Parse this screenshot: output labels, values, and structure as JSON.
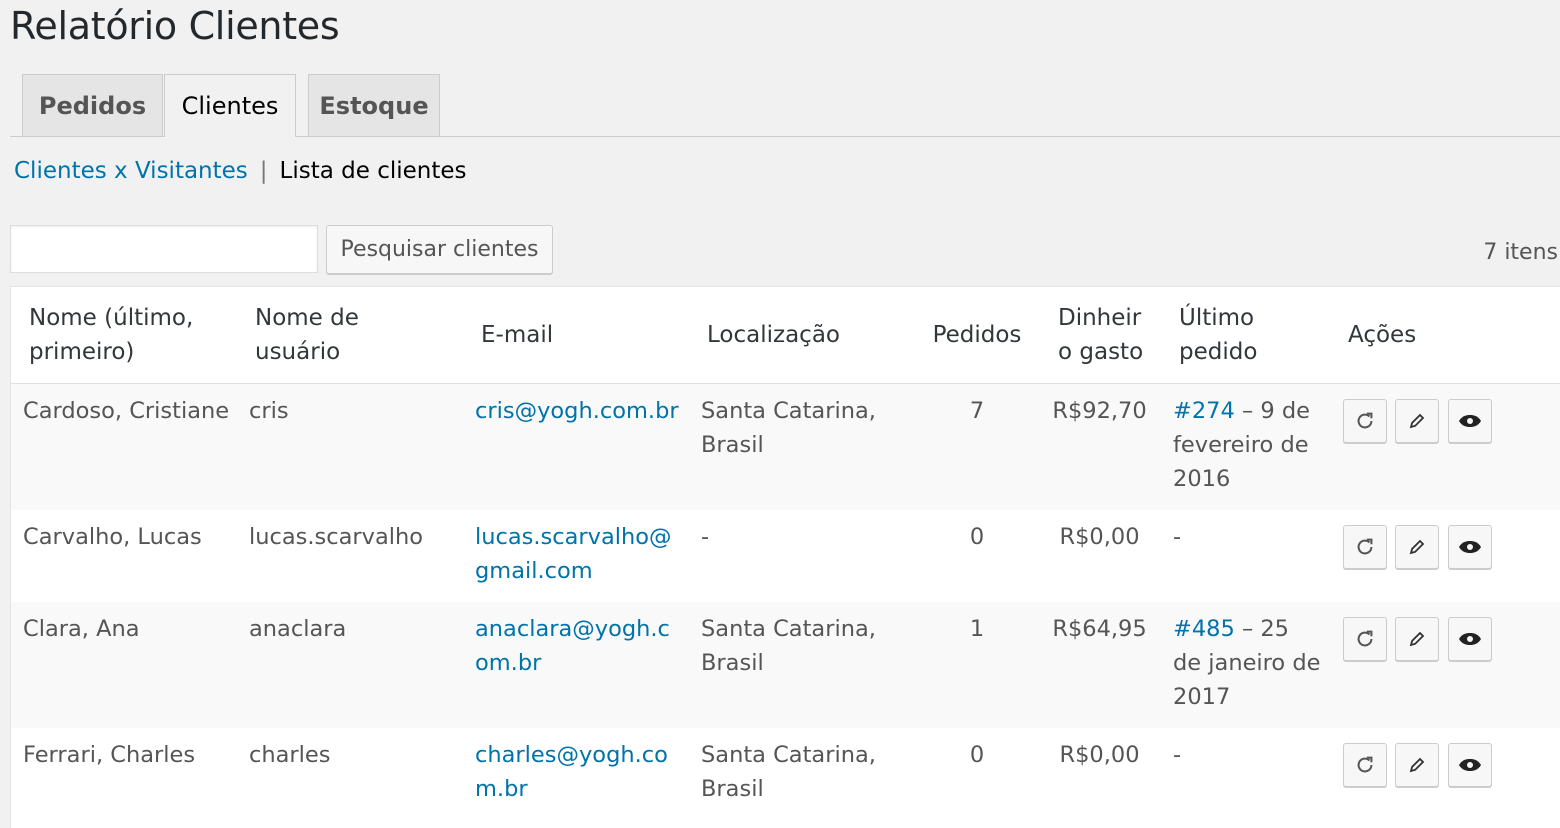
{
  "page": {
    "title": "Relatório Clientes"
  },
  "tabs": [
    {
      "label": "Pedidos",
      "active": false
    },
    {
      "label": "Clientes",
      "active": true
    },
    {
      "label": "Estoque",
      "active": false
    }
  ],
  "subnav": {
    "link": "Clientes x Visitantes",
    "separator": "|",
    "current": "Lista de clientes"
  },
  "search": {
    "value": "",
    "button_label": "Pesquisar clientes"
  },
  "items_count": "7 itens",
  "table": {
    "columns": [
      "Nome (último, primeiro)",
      "Nome de usuário",
      "E-mail",
      "Localização",
      "Pedidos",
      "Dinheiro gasto",
      "Último pedido",
      "Ações"
    ],
    "rows": [
      {
        "name": "Cardoso, Cristiane",
        "username": "cris",
        "email": "cris@yogh.com.br",
        "location": "Santa Catarina, Brasil",
        "orders": "7",
        "spent": "R$92,70",
        "last_order_link": "#274",
        "last_order_text": " – 9 de fevereiro de 2016"
      },
      {
        "name": "Carvalho, Lucas",
        "username": "lucas.scarvalho",
        "email": "lucas.scarvalho@gmail.com",
        "location": "-",
        "orders": "0",
        "spent": "R$0,00",
        "last_order_link": "",
        "last_order_text": "-"
      },
      {
        "name": "Clara, Ana",
        "username": "anaclara",
        "email": "anaclara@yogh.com.br",
        "location": "Santa Catarina, Brasil",
        "orders": "1",
        "spent": "R$64,95",
        "last_order_link": "#485",
        "last_order_text": " – 25 de janeiro de 2017"
      },
      {
        "name": "Ferrari, Charles",
        "username": "charles",
        "email": "charles@yogh.com.br",
        "location": "Santa Catarina, Brasil",
        "orders": "0",
        "spent": "R$0,00",
        "last_order_link": "",
        "last_order_text": "-"
      }
    ],
    "action_icons": [
      "refresh-icon",
      "pencil-icon",
      "eye-icon"
    ]
  }
}
